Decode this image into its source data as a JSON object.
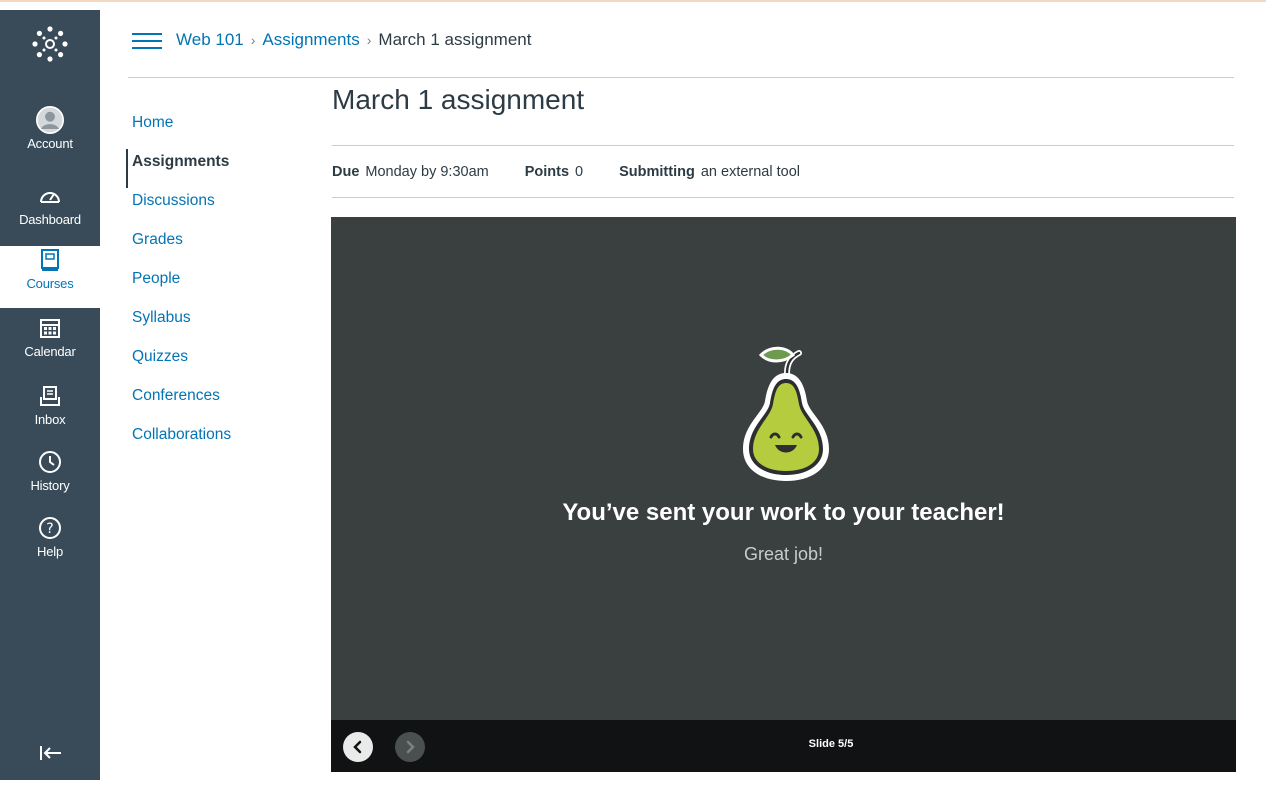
{
  "global_nav": {
    "logo_icon": "canvas-logo-icon",
    "items": [
      {
        "label": "Account",
        "icon": "avatar-icon"
      },
      {
        "label": "Dashboard",
        "icon": "dashboard-icon"
      },
      {
        "label": "Courses",
        "icon": "courses-icon"
      },
      {
        "label": "Calendar",
        "icon": "calendar-icon"
      },
      {
        "label": "Inbox",
        "icon": "inbox-icon"
      },
      {
        "label": "History",
        "icon": "history-icon"
      },
      {
        "label": "Help",
        "icon": "help-icon"
      }
    ],
    "active": "Courses",
    "collapse_icon": "collapse-nav-icon"
  },
  "breadcrumb": {
    "course": "Web 101",
    "section": "Assignments",
    "current": "March 1 assignment"
  },
  "course_nav": {
    "items": [
      "Home",
      "Assignments",
      "Discussions",
      "Grades",
      "People",
      "Syllabus",
      "Quizzes",
      "Conferences",
      "Collaborations"
    ],
    "active": "Assignments"
  },
  "assignment": {
    "title": "March 1 assignment",
    "due_label": "Due",
    "due_value": "Monday by 9:30am",
    "points_label": "Points",
    "points_value": "0",
    "submitting_label": "Submitting",
    "submitting_value": "an external tool"
  },
  "tool": {
    "message": "You’ve sent your work to your teacher!",
    "sub_message": "Great job!",
    "slide_counter": "Slide 5/5",
    "mascot_icon": "pear-mascot-icon"
  },
  "colors": {
    "nav_bg": "#394b58",
    "link": "#0374b5",
    "tool_bg": "#3a3f40",
    "tool_bar_bg": "#101213",
    "pear_green": "#b5cc3f"
  }
}
